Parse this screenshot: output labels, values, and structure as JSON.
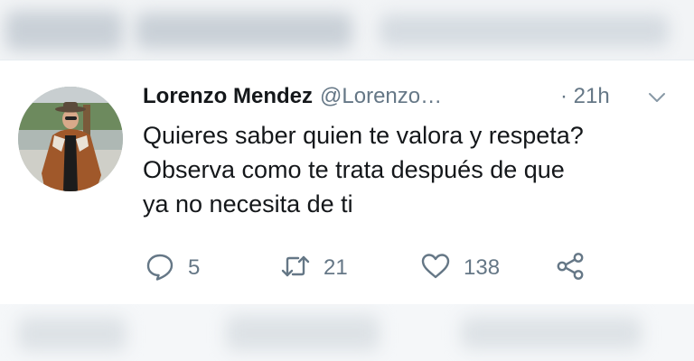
{
  "tweet": {
    "author_name": "Lorenzo Mendez",
    "handle": "@Lorenzo…",
    "time": "· 21h",
    "text_lines": [
      "Quieres saber quien te valora y respeta?",
      "Observa como te trata después de que",
      "ya no necesita de ti"
    ],
    "actions": {
      "reply_count": "5",
      "retweet_count": "21",
      "like_count": "138"
    }
  },
  "colors": {
    "text_primary": "#14171a",
    "text_secondary": "#657786",
    "divider": "#e6ecf0"
  },
  "icons": {
    "avatar": "profile-photo",
    "menu": "chevron-down-icon",
    "reply": "reply-icon",
    "retweet": "retweet-icon",
    "like": "heart-icon",
    "share": "share-icon"
  }
}
